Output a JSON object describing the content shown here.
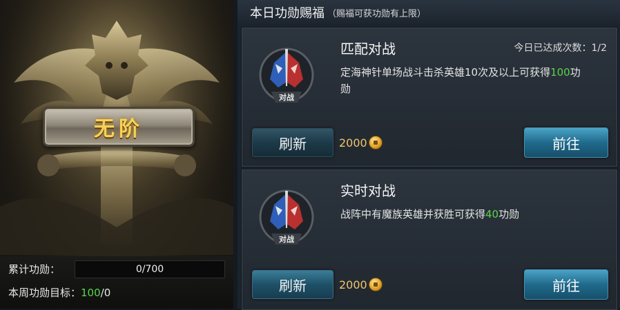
{
  "left_panel": {
    "rank_name": "无阶",
    "cumulative_label": "累计功勋：",
    "cumulative_progress": "0/700",
    "weekly_goal_label": "本周功勋目标：",
    "weekly_goal_current": "100",
    "weekly_goal_sep": "/0"
  },
  "header": {
    "title": "本日功勋赐福",
    "subtitle": "（赐福可获功勋有上限）"
  },
  "tasks": [
    {
      "title": "匹配对战",
      "count_text": "今日已达成次数：1/2",
      "badge_text": "对战",
      "desc_prefix": "定海神针单场战斗击杀英雄10次及以上可获得",
      "desc_value": "100",
      "desc_suffix": "功勋",
      "refresh_label": "刷新",
      "cost": "2000",
      "go_label": "前往"
    },
    {
      "title": "实时对战",
      "count_text": "",
      "badge_text": "对战",
      "desc_prefix": "战阵中有魔族英雄并获胜可获得",
      "desc_value": "40",
      "desc_suffix": "功勋",
      "refresh_label": "刷新",
      "cost": "2000",
      "go_label": "前往"
    }
  ],
  "colors": {
    "highlight_green": "#59d64a",
    "gold_text": "#f3d35a",
    "button_blue": "#206a8c"
  },
  "icons": [
    "rank-emblem-icon",
    "battle-badge-icon",
    "gold-coin-icon"
  ]
}
